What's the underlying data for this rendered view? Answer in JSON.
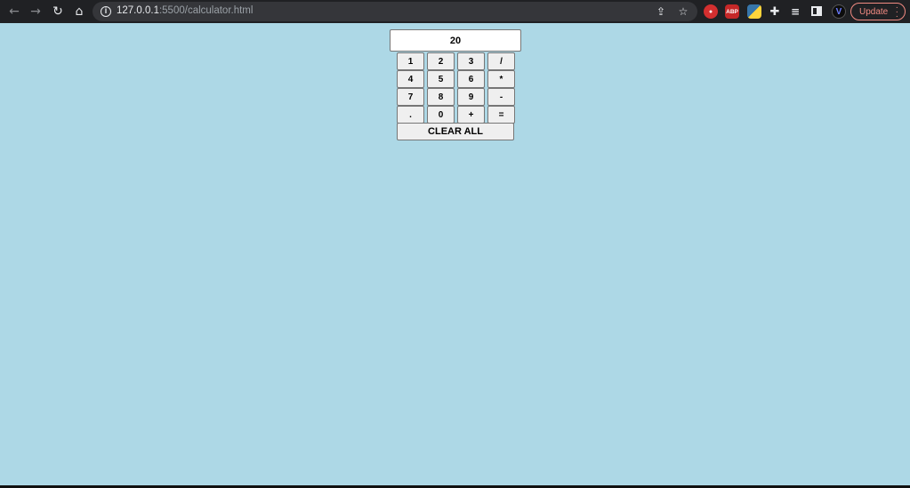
{
  "browser": {
    "url_host": "127.0.0.1",
    "url_rest": ":5500/calculator.html",
    "update_label": "Update",
    "ext_abp": "ABP"
  },
  "calculator": {
    "display_value": "20",
    "rows": [
      [
        "1",
        "2",
        "3",
        "/"
      ],
      [
        "4",
        "5",
        "6",
        "*"
      ],
      [
        "7",
        "8",
        "9",
        "-"
      ],
      [
        ".",
        "0",
        "+",
        "="
      ]
    ],
    "clear_label": "CLEAR ALL"
  }
}
